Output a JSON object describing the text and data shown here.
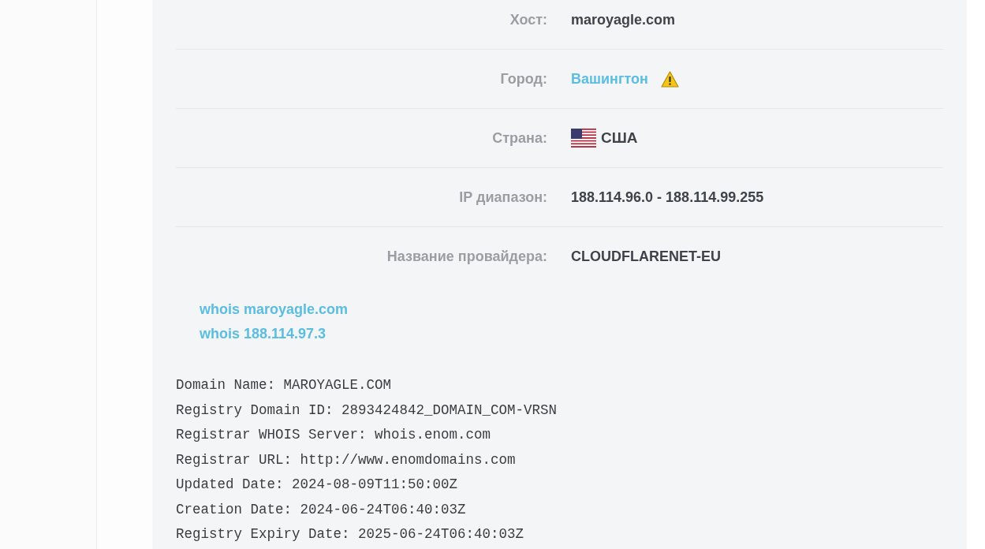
{
  "info_rows": [
    {
      "label": "Хост:",
      "value": "maroyagle.com",
      "kind": "text"
    },
    {
      "label": "Город:",
      "value": "Вашингтон",
      "kind": "link_warning"
    },
    {
      "label": "Страна:",
      "value": "США",
      "kind": "flag"
    },
    {
      "label": "IP диапазон:",
      "value": "188.114.96.0 - 188.114.99.255",
      "kind": "text"
    },
    {
      "label": "Название провайдера:",
      "value": "CLOUDFLARENET-EU",
      "kind": "text"
    }
  ],
  "whois_links": [
    "whois maroyagle.com",
    "whois 188.114.97.3"
  ],
  "whois_lines": [
    "Domain Name: MAROYAGLE.COM",
    "Registry Domain ID: 2893424842_DOMAIN_COM-VRSN",
    "Registrar WHOIS Server: whois.enom.com",
    "Registrar URL: http://www.enomdomains.com",
    "Updated Date: 2024-08-09T11:50:00Z",
    "Creation Date: 2024-06-24T06:40:03Z",
    "Registry Expiry Date: 2025-06-24T06:40:03Z"
  ]
}
